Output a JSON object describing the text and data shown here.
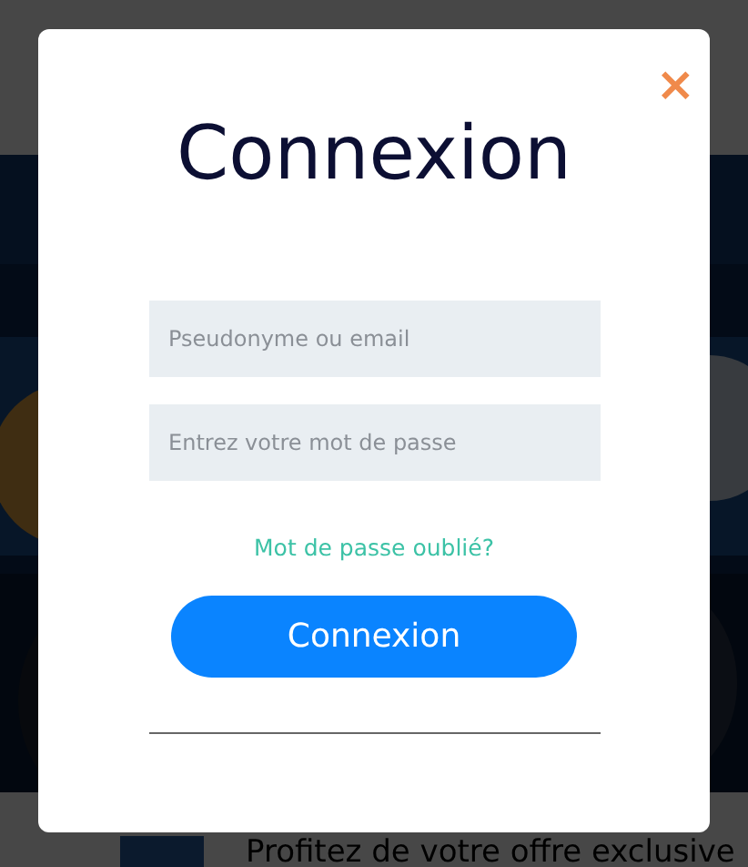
{
  "background_page": {
    "offer_text": "Profitez de votre offre exclusive"
  },
  "login_dialog": {
    "close": "×",
    "title": "Connexion",
    "fields": [
      {
        "placeholder": "Pseudonyme ou email"
      },
      {
        "placeholder": "Entrez votre mot de passe"
      }
    ],
    "forgot_link": "Mot de passe oublié?",
    "submit_button": "Connexion"
  }
}
